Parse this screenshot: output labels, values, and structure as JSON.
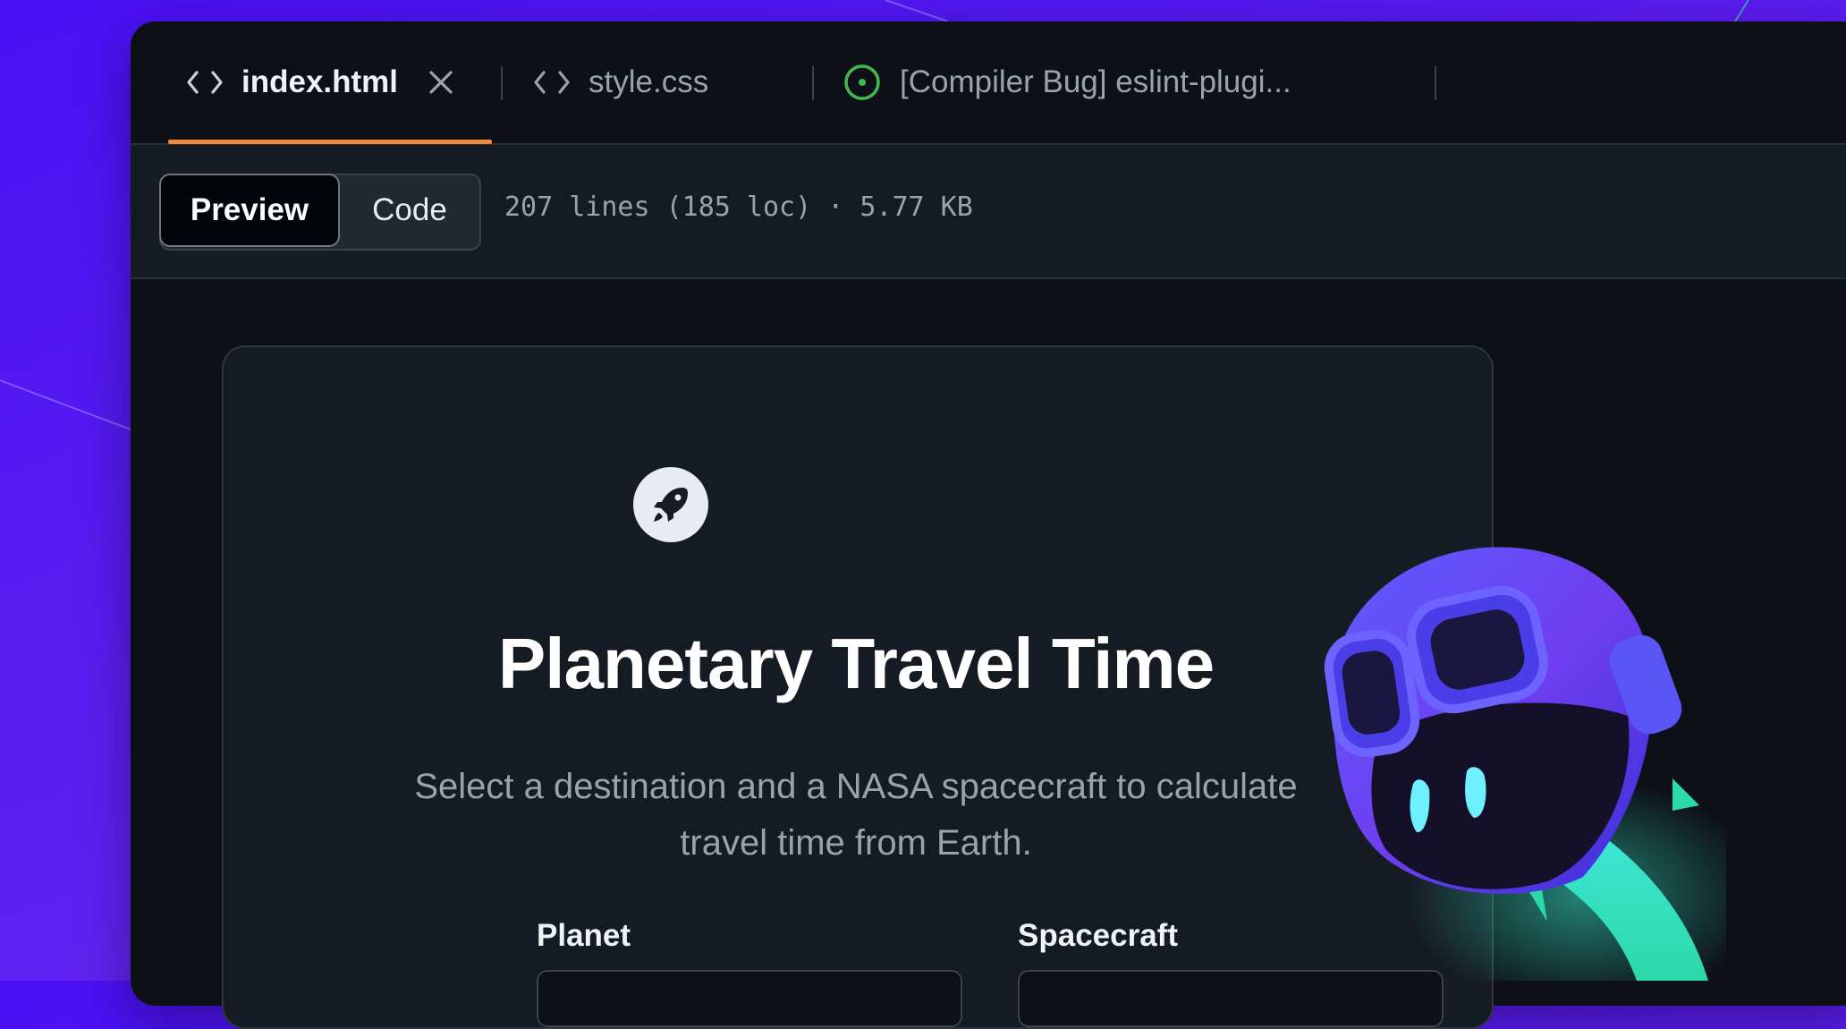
{
  "tabs": [
    {
      "label": "index.html",
      "icon": "code-icon",
      "active": true,
      "closable": true
    },
    {
      "label": "style.css",
      "icon": "code-icon",
      "active": false
    },
    {
      "label": "[Compiler Bug] eslint-plugi...",
      "icon": "issue-open-icon",
      "active": false
    }
  ],
  "toolbar": {
    "preview_label": "Preview",
    "code_label": "Code",
    "file_meta": "207 lines (185 loc) · 5.77 KB"
  },
  "card": {
    "icon": "rocket-icon",
    "title": "Planetary Travel Time",
    "subtitle_line1": "Select a destination and a NASA spacecraft to calculate",
    "subtitle_line2": "travel time from Earth.",
    "planet_label": "Planet",
    "spacecraft_label": "Spacecraft"
  },
  "colors": {
    "background": "#5a1cf0",
    "window": "#0d1117",
    "active_tab_underline": "#f0883e",
    "issue_icon": "#3fb950"
  }
}
